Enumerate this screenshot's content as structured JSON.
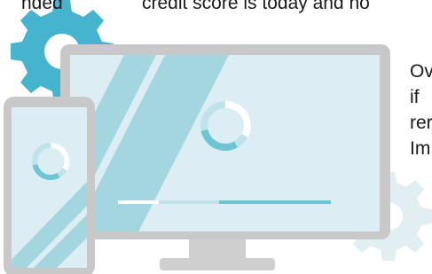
{
  "text": {
    "top_left_fragment": "nded",
    "top_line": "credit score is today and ho",
    "right_lines": [
      "Ov",
      "if",
      "rer",
      "Im"
    ]
  },
  "colors": {
    "gear_blue": "#46b3cf",
    "gear_pale": "#e1eff3",
    "device_frame": "#c8c8c8",
    "screen_bg": "#dceef3",
    "stripe": "#a3d6de",
    "accent_teal": "#6cc7d2",
    "ring_track": "#bfe3ea",
    "white": "#ffffff",
    "stand": "#cfcfcf"
  },
  "illustration": {
    "icons": [
      "gear-icon",
      "gear-icon",
      "desktop-monitor-icon",
      "smartphone-icon"
    ],
    "monitor_progress_fraction": 0.55,
    "monitor_ring_fraction": 0.3,
    "phone_ring_fraction": 0.3
  }
}
